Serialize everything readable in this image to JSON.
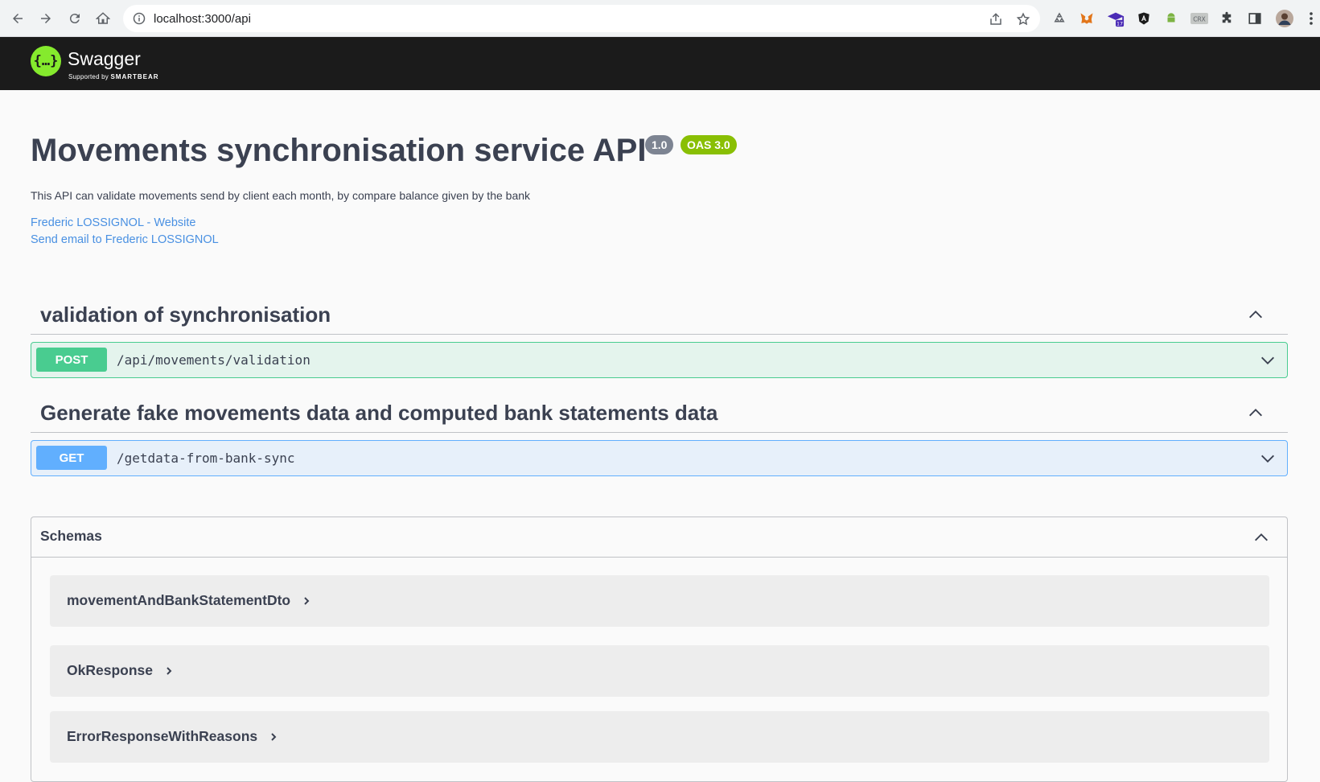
{
  "browser": {
    "url": "localhost:3000/api"
  },
  "swagger": {
    "logo_text": "Swagger",
    "logo_sub": "Supported by",
    "logo_sub_brand": "SMARTBEAR"
  },
  "info": {
    "title": "Movements synchronisation service API",
    "version": "1.0",
    "oas": "OAS 3.0",
    "description": "This API can validate movements send by client each month, by compare balance given by the bank",
    "links": [
      "Frederic LOSSIGNOL - Website",
      "Send email to Frederic LOSSIGNOL"
    ]
  },
  "tags": [
    {
      "name": "validation of synchronisation",
      "operation": {
        "method": "POST",
        "path": "/api/movements/validation"
      }
    },
    {
      "name": "Generate fake movements data and computed bank statements data",
      "operation": {
        "method": "GET",
        "path": "/getdata-from-bank-sync"
      }
    }
  ],
  "schemas": {
    "title": "Schemas",
    "items": [
      "movementAndBankStatementDto",
      "OkResponse",
      "ErrorResponseWithReasons"
    ]
  },
  "colors": {
    "post": "#49cc90",
    "get": "#61affe",
    "topbar": "#1b1b1b",
    "logo": "#85ea2d",
    "oas_badge": "#89bf04",
    "version_badge": "#7d8492",
    "link": "#4990e2"
  }
}
